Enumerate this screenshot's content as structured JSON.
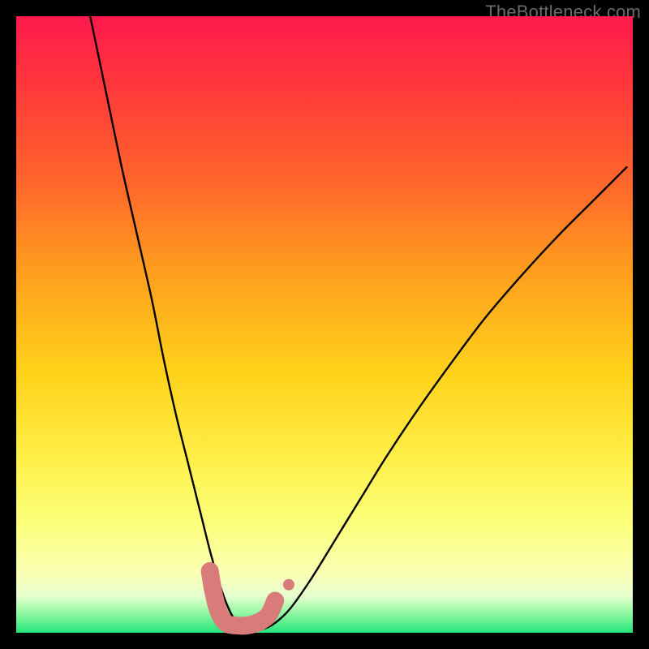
{
  "watermark": {
    "text": "TheBottleneck.com"
  },
  "colors": {
    "background": "#000000",
    "curve_stroke": "#000000",
    "marker_fill": "#d97b7b",
    "marker_stroke": "#d97b7b"
  },
  "chart_data": {
    "type": "line",
    "title": "",
    "xlabel": "",
    "ylabel": "",
    "xlim": [
      0,
      100
    ],
    "ylim": [
      0,
      100
    ],
    "note": "No axes, ticks, or labels are rendered. x and y are expressed as percent of the visible plot area; y=0 is the bottom edge, y=100 is the top edge. Values are read from the image at pixel precision.",
    "series": [
      {
        "name": "bottleneck-curve",
        "x": [
          12.0,
          14.5,
          17.0,
          19.5,
          22.0,
          24.0,
          26.0,
          28.0,
          30.0,
          31.5,
          32.8,
          34.0,
          35.2,
          36.5,
          38.0,
          40.0,
          42.0,
          44.5,
          48.0,
          52.0,
          56.0,
          60.0,
          65.0,
          70.0,
          76.0,
          82.0,
          88.0,
          94.0,
          99.0
        ],
        "y": [
          100.0,
          88.0,
          76.0,
          65.0,
          54.0,
          44.0,
          35.0,
          27.0,
          19.0,
          13.0,
          8.5,
          5.0,
          2.5,
          1.2,
          0.6,
          0.6,
          1.6,
          4.0,
          9.0,
          15.5,
          22.0,
          28.5,
          36.0,
          43.0,
          51.0,
          58.0,
          64.5,
          70.5,
          75.5
        ]
      }
    ],
    "markers": {
      "name": "highlight-rounded-band",
      "shape": "rounded-path",
      "color": "#d97b7b",
      "points_x": [
        31.4,
        32.0,
        32.8,
        34.0,
        35.5,
        37.5,
        39.5,
        41.0,
        42.0
      ],
      "points_y": [
        10.0,
        6.5,
        3.5,
        1.6,
        1.2,
        1.2,
        1.8,
        3.0,
        5.2
      ],
      "extra_dot": {
        "x": 44.2,
        "y": 7.8
      }
    }
  }
}
